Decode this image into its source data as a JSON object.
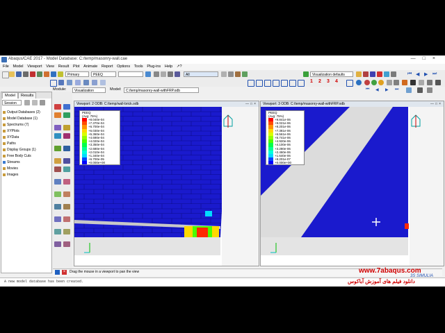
{
  "window": {
    "title": "Abaqus/CAE 2017 - Model Database: C:/temp/masonry-wall.cae"
  },
  "menu": [
    "File",
    "Model",
    "Viewport",
    "View",
    "Result",
    "Plot",
    "Animate",
    "Report",
    "Options",
    "Tools",
    "Plug-ins",
    "Help",
    "↗?"
  ],
  "toolbar": {
    "primary_value": "Primary",
    "variable_value": "PEEQ",
    "filter_value": "All",
    "vis_defaults": "Visualization defaults",
    "numbers": [
      "1",
      "2",
      "3",
      "4"
    ]
  },
  "context": {
    "module_label": "Module:",
    "module_value": "Visualization",
    "model_label": "Model:",
    "model_value": "C:/temp/masonry-wall-withFRP.odb"
  },
  "left_panel": {
    "tabs": [
      "Model",
      "Results"
    ],
    "session_label": "Session",
    "tree": [
      "Output Databases (2)",
      "Model Database (1)",
      "Spectrums (7)",
      "XYPlots",
      "XYData",
      "Paths",
      "Display Groups (1)",
      "Free Body Cuts",
      "Streams",
      "Movies",
      "Images"
    ]
  },
  "viewport2": {
    "title": "Viewport: 2    ODB: C:/temp/wall-brick.odb",
    "legend_title": "PEEQ",
    "legend_sub": "(Avg: 75%)",
    "legend_values": [
      "+8.040e-04",
      "+7.370e-04",
      "+6.700e-04",
      "+6.030e-04",
      "+5.360e-04",
      "+4.690e-04",
      "+4.020e-04",
      "+3.350e-04",
      "+2.680e-04",
      "+2.010e-04",
      "+1.340e-04",
      "+6.700e-05",
      "+0.000e+00"
    ],
    "legend_colors": [
      "#ff0000",
      "#ff4a00",
      "#ff9200",
      "#ffd800",
      "#d9ff00",
      "#92ff00",
      "#4aff00",
      "#00ff49",
      "#00ff92",
      "#00ffdb",
      "#00dbff",
      "#0049ff",
      "#0000ff"
    ]
  },
  "viewport3": {
    "title": "Viewport: 3    ODB: C:/temp/masonry-wall-withFRP.odb",
    "legend_title": "PEEQ",
    "legend_sub": "(Avg: 75%)",
    "legend_values": [
      "+9.841e-06",
      "+9.021e-06",
      "+8.201e-06",
      "+7.381e-06",
      "+6.561e-06",
      "+5.741e-06",
      "+4.920e-06",
      "+4.100e-06",
      "+3.280e-06",
      "+2.460e-06",
      "+1.640e-06",
      "+8.201e-07",
      "+0.000e+00"
    ],
    "legend_colors": [
      "#ff0000",
      "#ff4a00",
      "#ff9200",
      "#ffd800",
      "#d9ff00",
      "#92ff00",
      "#4aff00",
      "#00ff49",
      "#00ff92",
      "#00ffdb",
      "#00dbff",
      "#0049ff",
      "#0000ff"
    ]
  },
  "status": {
    "prompt": "Drag the mouse in a viewport to pan the view"
  },
  "message": {
    "text": "A new model database has been created."
  },
  "watermark": {
    "url": "www.7abaqus.com",
    "brand": "3S SIMULIA",
    "tagline": "دانلود فیلم های آموزش آباکوس"
  },
  "colors": {
    "mesh_blue": "#1a1acd",
    "grey_region": "#dcdcdc",
    "brand_red": "#d00000"
  }
}
